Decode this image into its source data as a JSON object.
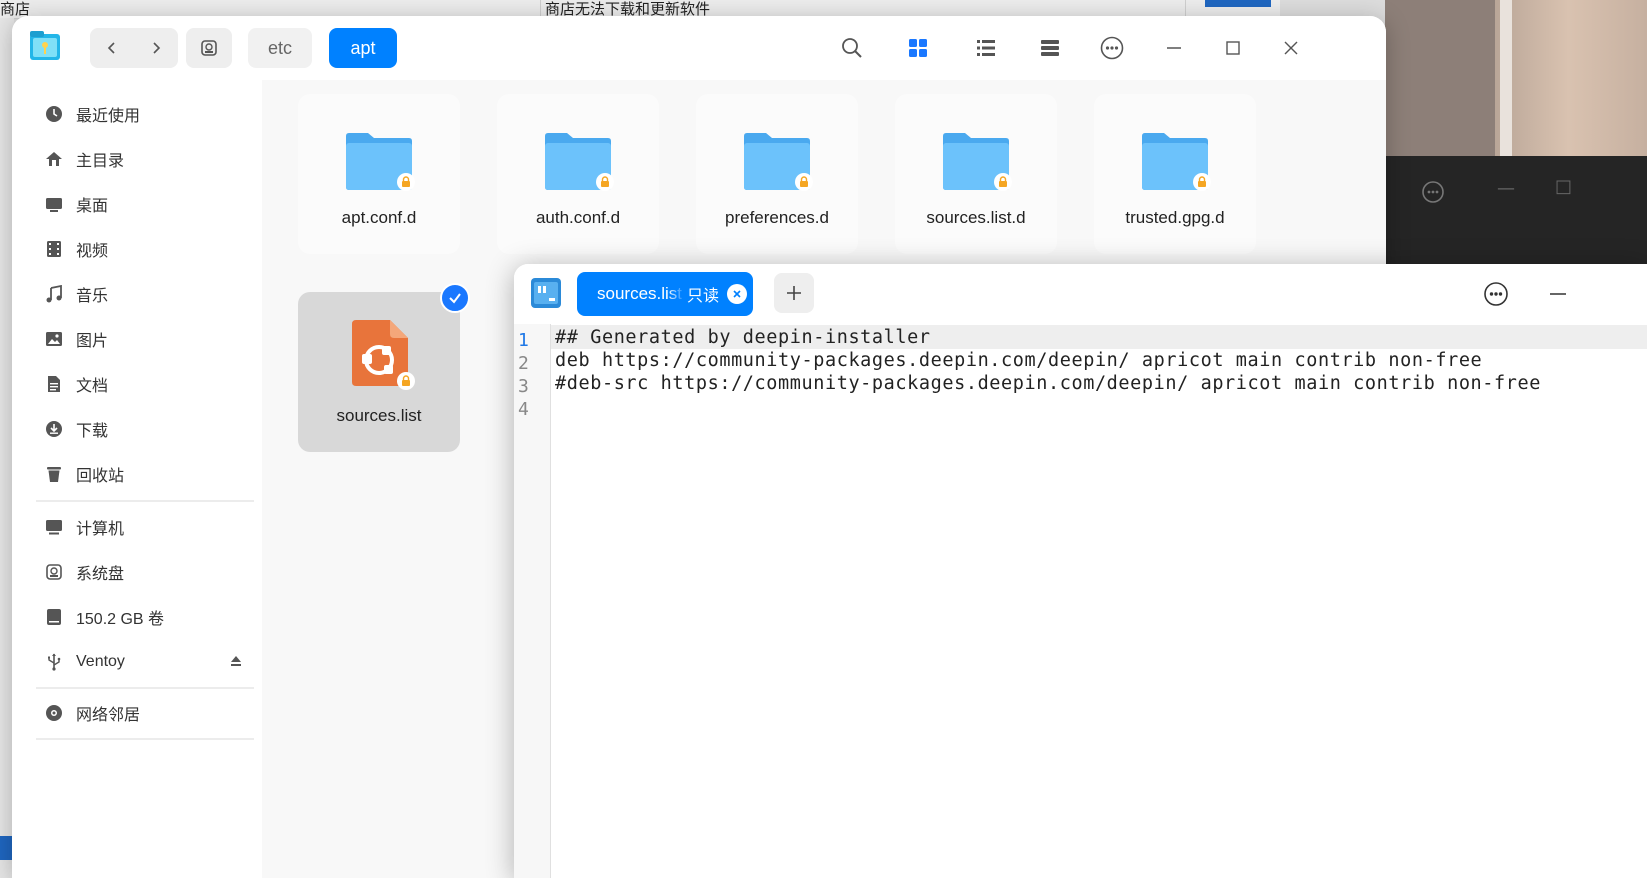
{
  "background": {
    "top_left_text": "商店",
    "top_center_text": "商店无法下载和更新软件"
  },
  "file_manager": {
    "breadcrumbs": [
      "etc",
      "apt"
    ],
    "sidebar": {
      "items": [
        {
          "label": "最近使用",
          "icon": "clock-icon"
        },
        {
          "label": "主目录",
          "icon": "home-icon"
        },
        {
          "label": "桌面",
          "icon": "desktop-icon"
        },
        {
          "label": "视频",
          "icon": "video-icon"
        },
        {
          "label": "音乐",
          "icon": "music-icon"
        },
        {
          "label": "图片",
          "icon": "picture-icon"
        },
        {
          "label": "文档",
          "icon": "document-icon"
        },
        {
          "label": "下载",
          "icon": "download-icon"
        },
        {
          "label": "回收站",
          "icon": "trash-icon"
        }
      ],
      "devices": [
        {
          "label": "计算机",
          "icon": "computer-icon"
        },
        {
          "label": "系统盘",
          "icon": "system-disk-icon"
        },
        {
          "label": "150.2 GB 卷",
          "icon": "volume-icon"
        },
        {
          "label": "Ventoy",
          "icon": "usb-icon"
        }
      ],
      "network": [
        {
          "label": "网络邻居",
          "icon": "network-icon"
        }
      ]
    },
    "files": [
      {
        "name": "apt.conf.d",
        "type": "folder",
        "locked": true
      },
      {
        "name": "auth.conf.d",
        "type": "folder",
        "locked": true
      },
      {
        "name": "preferences.d",
        "type": "folder",
        "locked": true
      },
      {
        "name": "sources.list.d",
        "type": "folder",
        "locked": true
      },
      {
        "name": "trusted.gpg.d",
        "type": "folder",
        "locked": true
      },
      {
        "name": "sources.list",
        "type": "file",
        "locked": true,
        "selected": true
      }
    ]
  },
  "editor": {
    "tab": {
      "filename": "sources.list",
      "status": "只读"
    },
    "line_numbers": [
      "1",
      "2",
      "3",
      "4"
    ],
    "lines": [
      "## Generated by deepin-installer",
      "deb https://community-packages.deepin.com/deepin/ apricot main contrib non-free",
      "#deb-src https://community-packages.deepin.com/deepin/ apricot main contrib non-free",
      ""
    ]
  },
  "colors": {
    "accent": "#0081ff",
    "folder": "#5cb8f7",
    "file_icon": "#e8743b",
    "lock": "#f5a623"
  }
}
